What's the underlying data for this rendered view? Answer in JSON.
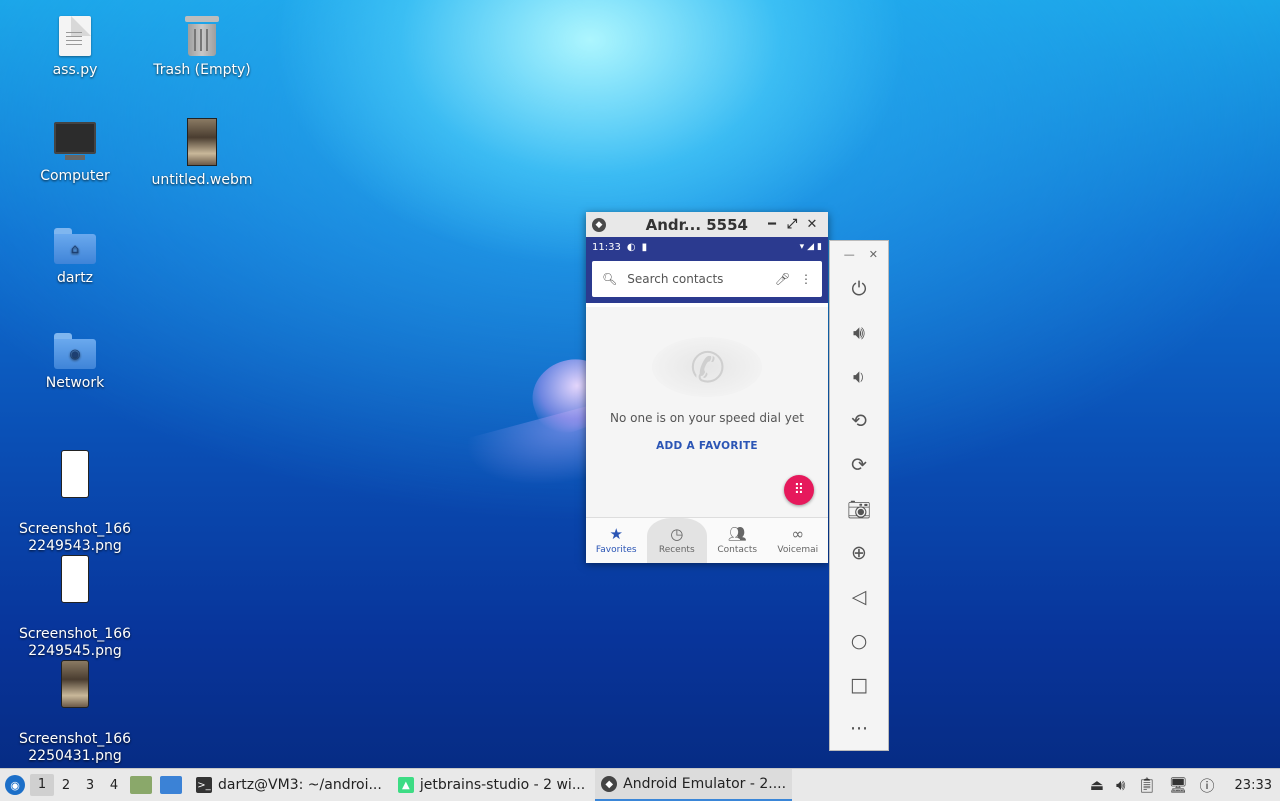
{
  "desktop": {
    "icons": [
      {
        "label": "ass.py"
      },
      {
        "label": "Trash (Empty)"
      },
      {
        "label": "Computer"
      },
      {
        "label": "untitled.webm"
      },
      {
        "label": "dartz"
      },
      {
        "label": "Network"
      },
      {
        "label": "Screenshot_166\n2249543.png"
      },
      {
        "label": "Screenshot_166\n2249545.png"
      },
      {
        "label": "Screenshot_166\n2250431.png"
      }
    ]
  },
  "emulator": {
    "title": "Andr... 5554",
    "status_time": "11:33",
    "search_placeholder": "Search contacts",
    "empty_message": "No one is on your speed dial yet",
    "add_favorite": "ADD A FAVORITE",
    "nav": [
      {
        "label": "Favorites",
        "icon": "star-icon"
      },
      {
        "label": "Recents",
        "icon": "clock-icon"
      },
      {
        "label": "Contacts",
        "icon": "people-icon"
      },
      {
        "label": "Voicemai",
        "icon": "voicemail-icon"
      }
    ]
  },
  "emulator_toolbar": {
    "buttons": [
      "power",
      "volume-up",
      "volume-down",
      "rotate-left",
      "rotate-right",
      "screenshot",
      "zoom",
      "back",
      "home",
      "overview",
      "more"
    ]
  },
  "taskbar": {
    "workspaces": [
      "1",
      "2",
      "3",
      "4"
    ],
    "tasks": [
      {
        "label": "dartz@VM3: ~/androi..."
      },
      {
        "label": "jetbrains-studio - 2 wi..."
      },
      {
        "label": "Android Emulator - 2...."
      }
    ],
    "clock": "23:33"
  },
  "colors": {
    "accent": "#2b3a8f",
    "fab": "#e6195c",
    "link": "#2b55b5"
  }
}
